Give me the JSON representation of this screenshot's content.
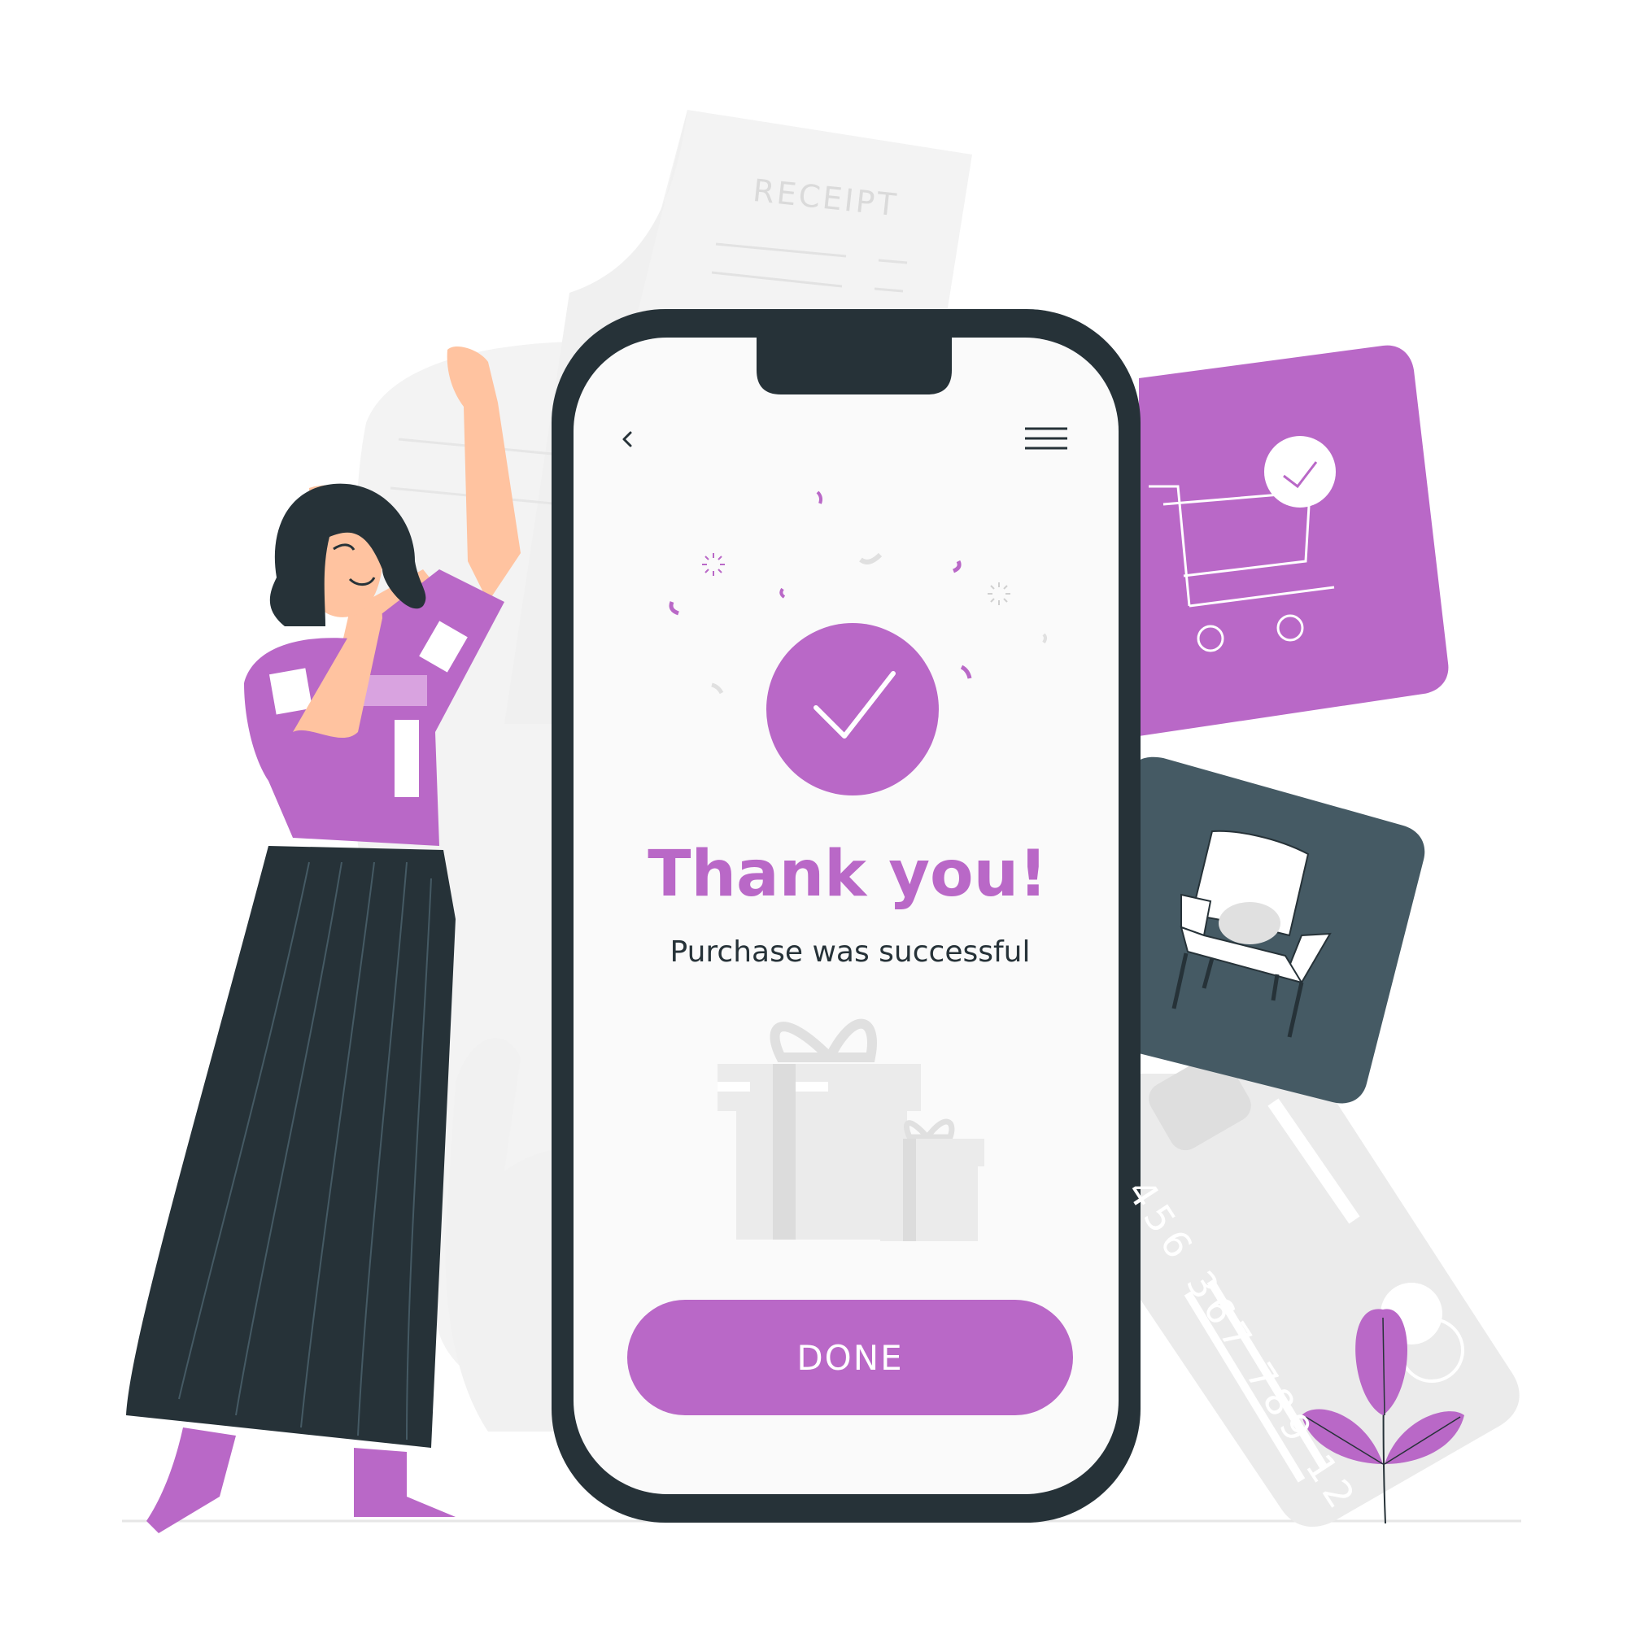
{
  "receipt": {
    "title": "RECEIPT"
  },
  "credit_card": {
    "number": "456 367 789 12"
  },
  "screen": {
    "back_icon": "chevron-left-icon",
    "menu_icon": "hamburger-menu-icon",
    "success_icon": "checkmark-icon",
    "title": "Thank you!",
    "subtitle": "Purchase was successful",
    "done_label": "DONE"
  },
  "colors": {
    "accent": "#b968c7",
    "dark": "#263238",
    "slate": "#455a64",
    "screen_bg": "#fafafa",
    "light_gray": "#ebebeb"
  }
}
